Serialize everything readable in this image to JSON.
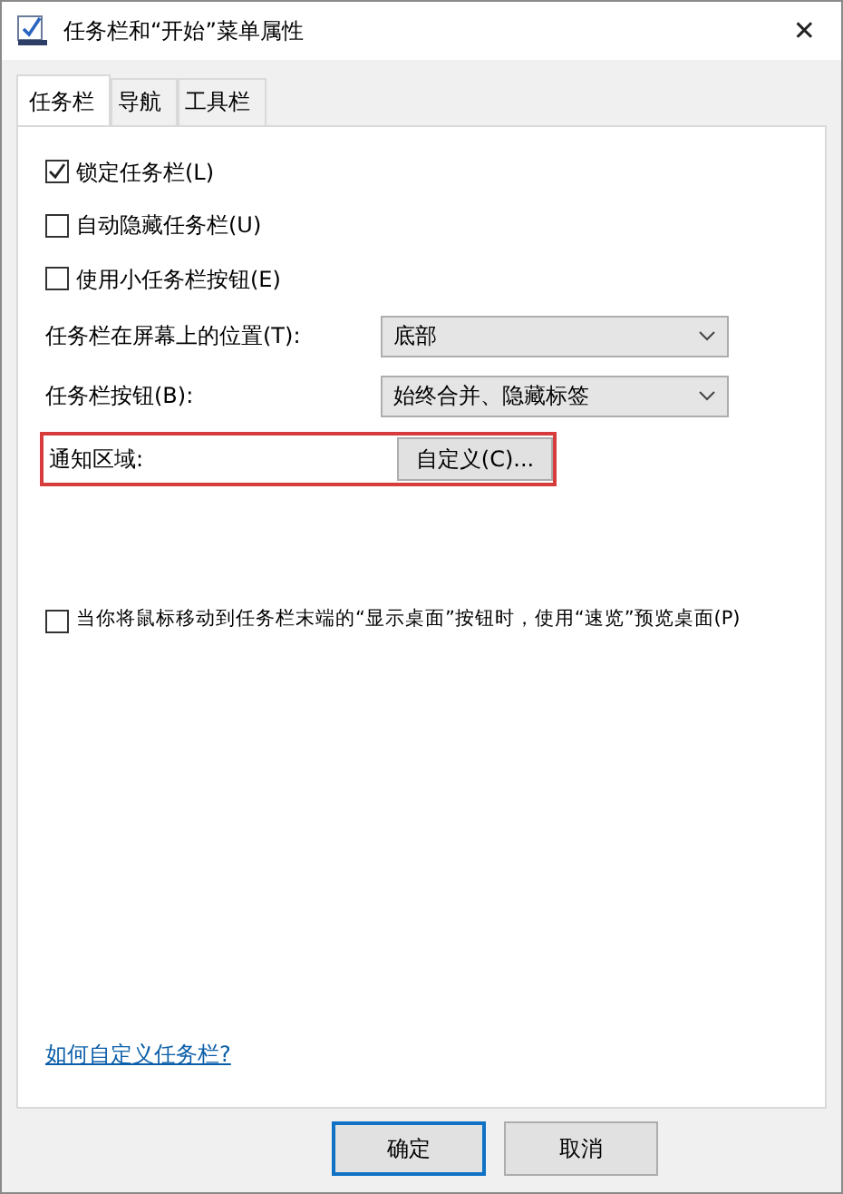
{
  "window": {
    "title": "任务栏和“开始”菜单属性",
    "close": "✕"
  },
  "tabs": [
    {
      "label": "任务栏",
      "selected": true
    },
    {
      "label": "导航",
      "selected": false
    },
    {
      "label": "工具栏",
      "selected": false
    }
  ],
  "options": [
    {
      "label": "锁定任务栏(L)",
      "checked": true
    },
    {
      "label": "自动隐藏任务栏(U)",
      "checked": false
    },
    {
      "label": "使用小任务栏按钮(E)",
      "checked": false
    }
  ],
  "dropdowns": [
    {
      "label": "任务栏在屏幕上的位置(T):",
      "value": "底部"
    },
    {
      "label": "任务栏按钮(B):",
      "value": "始终合并、隐藏标签"
    }
  ],
  "notification_area": {
    "label": "通知区域:",
    "button": "自定义(C)...",
    "highlighted": true
  },
  "peek_option": {
    "label": "当你将鼠标移动到任务栏末端的“显示桌面”按钮时，使用“速览”预览桌面(P)",
    "checked": false
  },
  "help_link": "如何自定义任务栏?",
  "buttons": [
    {
      "label": "确定",
      "default": true
    },
    {
      "label": "取消",
      "default": false
    }
  ]
}
